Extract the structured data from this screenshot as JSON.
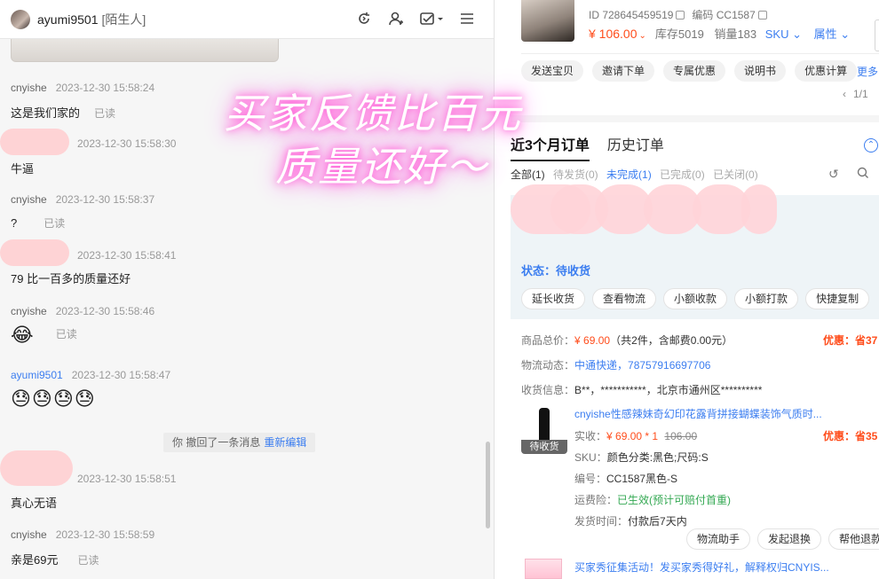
{
  "chat": {
    "header": {
      "name": "ayumi9501",
      "tag": "[陌生人]"
    },
    "messages": [
      {
        "sender": "cnyishe",
        "time": "2023-12-30 15:58:24",
        "text": "这是我们家的",
        "read": "已读"
      },
      {
        "sender": "",
        "time": "2023-12-30 15:58:30",
        "text": "牛逼"
      },
      {
        "sender": "cnyishe",
        "time": "2023-12-30 15:58:37",
        "text": "?",
        "read": "已读"
      },
      {
        "sender": "",
        "time": "2023-12-30 15:58:41",
        "text": "79 比一百多的质量还好"
      },
      {
        "sender": "cnyishe",
        "time": "2023-12-30 15:58:46",
        "text": "😂",
        "read": "已读"
      },
      {
        "sender": "ayumi9501",
        "time": "2023-12-30 15:58:47",
        "text": "😓😓😓😓"
      },
      {
        "sender": "",
        "time": "2023-12-30 15:58:51",
        "text": "真心无语"
      },
      {
        "sender": "cnyishe",
        "time": "2023-12-30 15:58:59",
        "text": "亲是69元",
        "read": "已读"
      }
    ],
    "recall": {
      "text": "你 撤回了一条消息",
      "link": "重新编辑"
    },
    "overlay": {
      "line1": "买家反馈比百元",
      "line2": "质量还好～"
    }
  },
  "product": {
    "id_label": "ID 728645459519",
    "code_label": "编码 CC1587",
    "price": "¥ 106.00",
    "stock": "库存5019",
    "sales": "销量183",
    "sku": "SKU",
    "attr": "属性"
  },
  "actions": [
    "发送宝贝",
    "邀请下单",
    "专属优惠",
    "说明书",
    "优惠计算"
  ],
  "more": "更多",
  "pager": "1/1",
  "tabs": [
    "近3个月订单",
    "历史订单"
  ],
  "filters": {
    "all": "全部(1)",
    "pending_ship": "待发货(0)",
    "unfinished": "未完成(1)",
    "done": "已完成(0)",
    "closed": "已关闭(0)"
  },
  "order": {
    "status": "状态：待收货",
    "buttons": [
      "延长收货",
      "查看物流",
      "小额收款",
      "小额打款",
      "快捷复制"
    ],
    "total_label": "商品总价：",
    "total_value": "¥ 69.00",
    "total_note": "（共2件，含邮费0.00元）",
    "discount1": "优惠：省37",
    "logistics_label": "物流动态：",
    "logistics_value": "中通快递，78757916697706",
    "address_label": "收货信息：",
    "address_value": "B**，***********，北京市通州区**********",
    "item": {
      "title": "cnyishe性感辣妹奇幻印花露背拼接蝴蝶装饰气质时...",
      "badge": "待收货",
      "paid_label": "实收：",
      "paid_value": "¥ 69.00 * 1",
      "orig_price": "106.00",
      "discount": "优惠：省35",
      "sku_label": "SKU：",
      "sku_value": "颜色分类:黑色;尺码:S",
      "code_label": "编号：",
      "code_value": "CC1587黑色-S",
      "insurance_label": "运费险：",
      "insurance_value": "已生效(预计可赔付首重)",
      "ship_label": "发货时间：",
      "ship_value": "付款后7天内"
    },
    "sub_buttons": [
      "物流助手",
      "发起退换",
      "帮他退款"
    ]
  },
  "promo": "买家秀征集活动！发买家秀得好礼，解释权归CNYIS..."
}
